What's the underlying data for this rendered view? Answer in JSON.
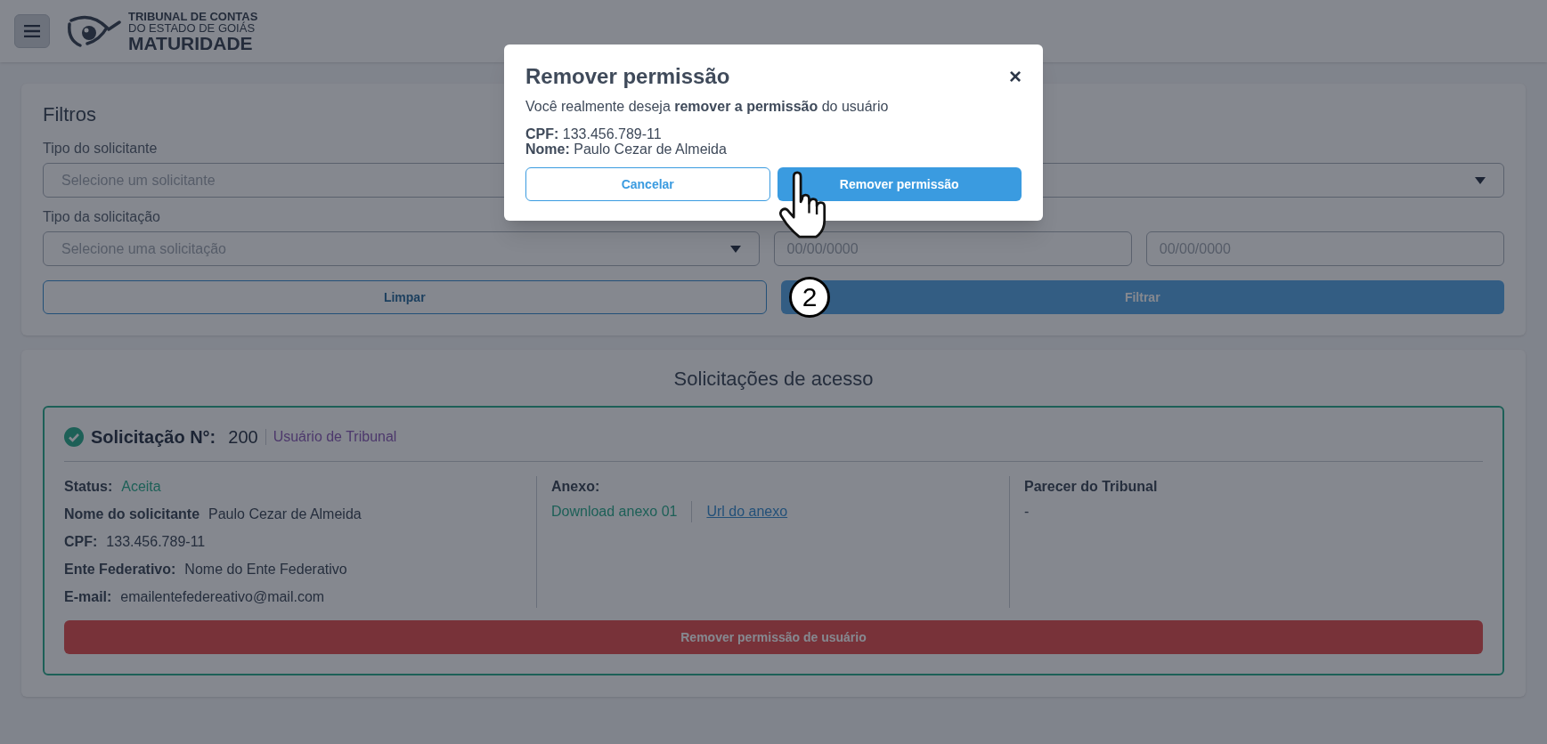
{
  "header": {
    "logo_lines": [
      "TRIBUNAL DE CONTAS",
      "DO ESTADO DE GOIÁS",
      "MATURIDADE"
    ]
  },
  "filters": {
    "title": "Filtros",
    "rows": [
      [
        {
          "kind": "select",
          "label": "Tipo do solicitante",
          "placeholder": "Selecione um solicitante"
        },
        {
          "kind": "select"
        }
      ],
      [
        {
          "kind": "select",
          "label": "Tipo da solicitação",
          "placeholder": "Selecione uma solicitação"
        },
        {
          "kind": "date",
          "placeholder": "00/00/0000"
        },
        {
          "kind": "date",
          "placeholder": "00/00/0000"
        }
      ]
    ],
    "clear_button": "Limpar",
    "filter_button": "Filtrar"
  },
  "requests": {
    "title": "Solicitações de acesso",
    "items": [
      {
        "heading": "Solicitação N°:",
        "number": "200",
        "type": "Usuário de Tribunal",
        "fields": [
          {
            "label": "Status:",
            "value": "Aceita",
            "kind": "status"
          },
          {
            "label": "Nome do solicitante",
            "value": "Paulo Cezar de Almeida",
            "kind": "text"
          },
          {
            "label": "CPF:",
            "value": "133.456.789-11",
            "kind": "text"
          },
          {
            "label": "Ente Federativo:",
            "value": "Nome do Ente Federativo",
            "kind": "text"
          },
          {
            "label": "E-mail:",
            "value": "emailentefedereativo@mail.com",
            "kind": "text"
          }
        ],
        "attachments_title": "Anexo:",
        "download_link": "Download anexo 01",
        "url_link": "Url do anexo",
        "opinion_title": "Parecer do Tribunal",
        "opinion": "-",
        "action_button": "Remover permissão de usuário"
      }
    ]
  },
  "modal": {
    "title": "Remover permissão",
    "close": "×",
    "message": "Você realmente deseja **remover a permissão** do usuário",
    "details": [
      "**CPF:** 133.456.789-11",
      "**Nome:** Paulo Cezar de Almeida"
    ],
    "cancel_button": "Cancelar",
    "confirm_button": "Remover permissão"
  },
  "step_badge": "2"
}
